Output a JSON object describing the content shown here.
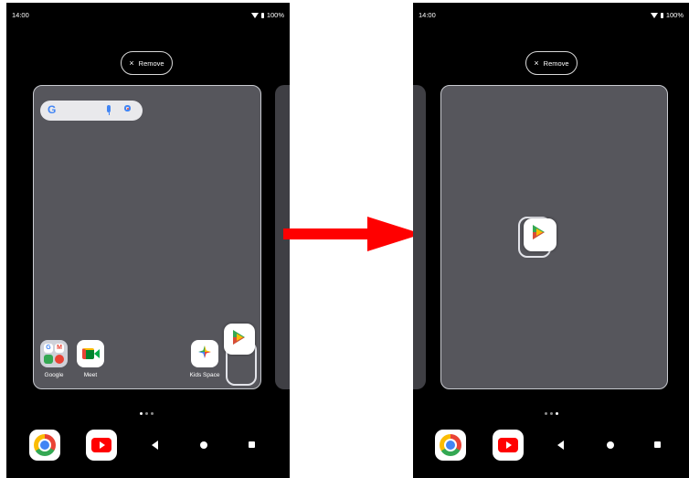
{
  "status_bar": {
    "time": "14:00",
    "battery": "100%"
  },
  "remove_button": {
    "icon": "×",
    "label": "Remove"
  },
  "left_screen": {
    "apps": [
      {
        "name": "Google"
      },
      {
        "name": "Meet"
      },
      {
        "name": "Kids Space"
      }
    ],
    "folder_letters": [
      "G",
      "M"
    ]
  },
  "icons": {
    "google_g": "G",
    "wifi": "wifi-icon",
    "battery": "battery-icon"
  },
  "colors": {
    "arrow": "#ff0000",
    "panel": "#56565c",
    "screen_bg": "#000000"
  }
}
